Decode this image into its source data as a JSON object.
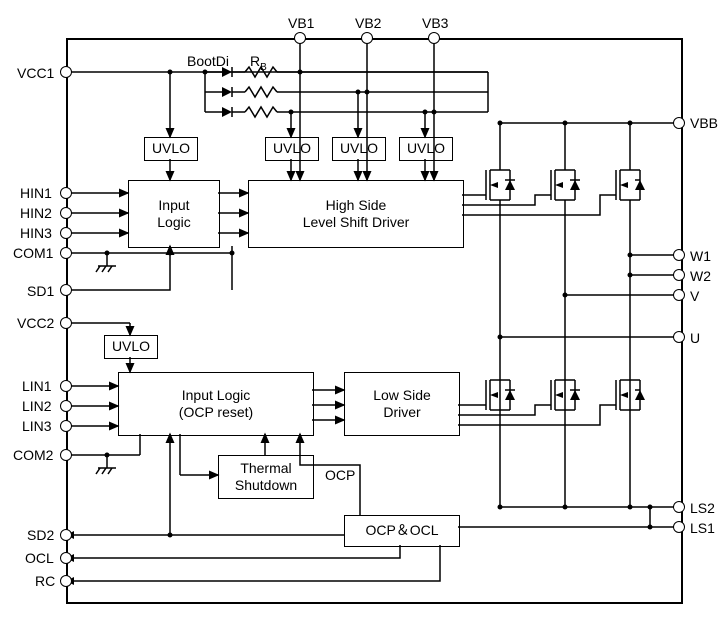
{
  "pins_left": {
    "vcc1": "VCC1",
    "hin1": "HIN1",
    "hin2": "HIN2",
    "hin3": "HIN3",
    "com1": "COM1",
    "sd1": "SD1",
    "vcc2": "VCC2",
    "lin1": "LIN1",
    "lin2": "LIN2",
    "lin3": "LIN3",
    "com2": "COM2",
    "sd2": "SD2",
    "ocl": "OCL",
    "rc": "RC"
  },
  "pins_top": {
    "vb1": "VB1",
    "vb2": "VB2",
    "vb3": "VB3"
  },
  "pins_right": {
    "vbb": "VBB",
    "w1": "W1",
    "w2": "W2",
    "v": "V",
    "u": "U",
    "ls2": "LS2",
    "ls1": "LS1"
  },
  "components": {
    "bootdi": "BootDi",
    "rb": "R",
    "rb_sub": "B"
  },
  "blocks": {
    "uvlo": "UVLO",
    "input_logic": "Input\nLogic",
    "high_side": "High Side\nLevel Shift Driver",
    "input_logic_ocp": "Input Logic\n(OCP reset)",
    "low_side": "Low Side\nDriver",
    "thermal": "Thermal\nShutdown",
    "ocp_ocl": "OCP＆OCL",
    "ocp_net": "OCP"
  }
}
